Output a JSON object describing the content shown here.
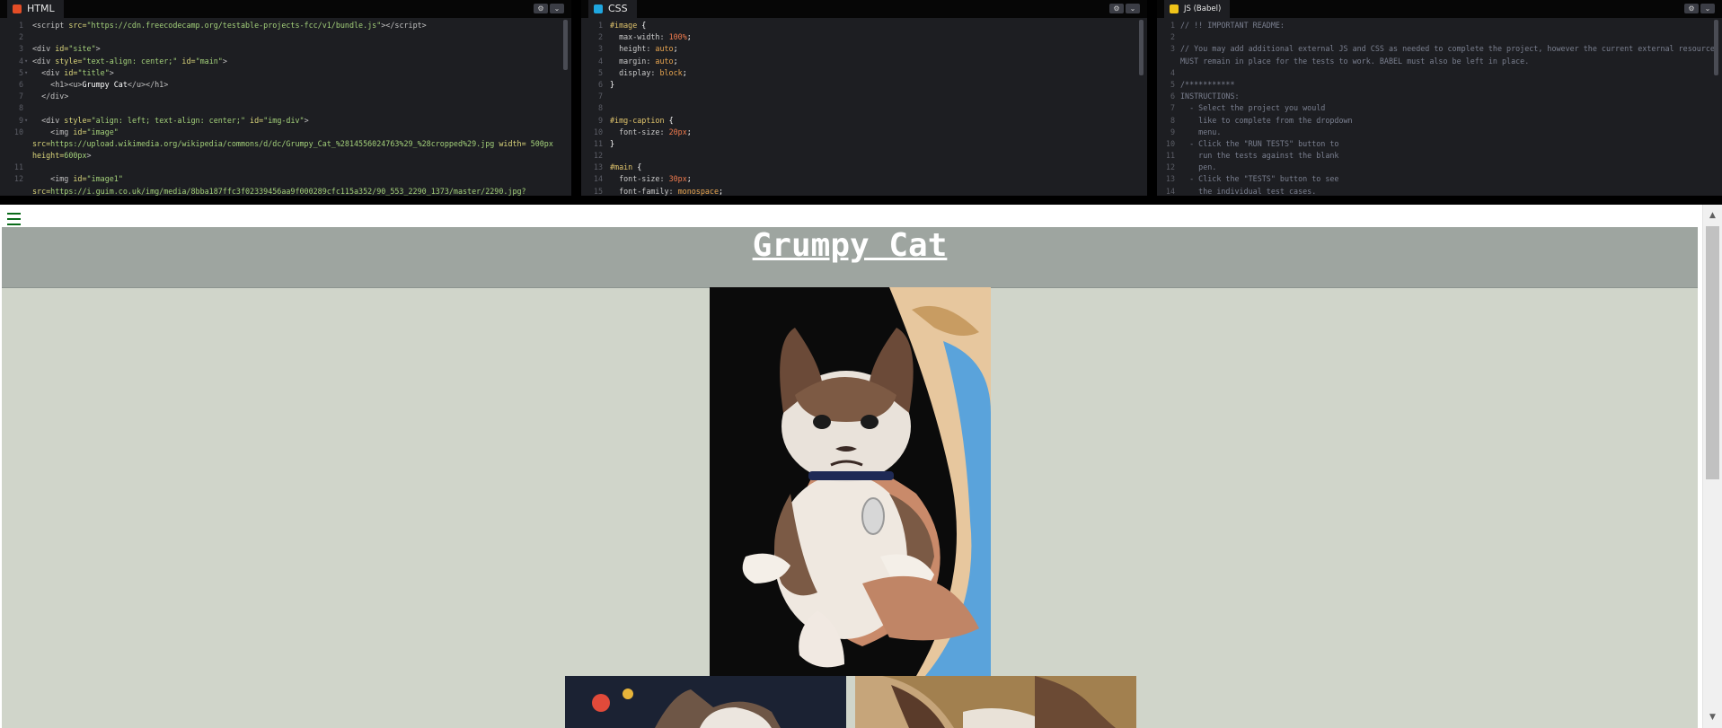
{
  "editors": {
    "html": {
      "label": "HTML",
      "badge_color": "#e44d26",
      "lines": [
        {
          "n": "1",
          "parts": [
            [
              "t-tag",
              "<script "
            ],
            [
              "t-attr",
              "src="
            ],
            [
              "t-str",
              "\"https://cdn.freecodecamp.org/testable-projects-fcc/v1/bundle.js\""
            ],
            [
              "t-tag",
              "></"
            ],
            [
              "t-tag",
              "script>"
            ]
          ]
        },
        {
          "n": "2",
          "parts": []
        },
        {
          "n": "3",
          "parts": [
            [
              "t-tag",
              "<div "
            ],
            [
              "t-attr",
              "id="
            ],
            [
              "t-str",
              "\"site\""
            ],
            [
              "t-tag",
              ">"
            ]
          ]
        },
        {
          "n": "4",
          "fold": true,
          "parts": [
            [
              "t-tag",
              "<div "
            ],
            [
              "t-attr",
              "style="
            ],
            [
              "t-str",
              "\"text-align: center;\""
            ],
            [
              "t-tag",
              " "
            ],
            [
              "t-attr",
              "id="
            ],
            [
              "t-str",
              "\"main\""
            ],
            [
              "t-tag",
              ">"
            ]
          ]
        },
        {
          "n": "5",
          "fold": true,
          "parts": [
            [
              "t-tag",
              "  <div "
            ],
            [
              "t-attr",
              "id="
            ],
            [
              "t-str",
              "\"title\""
            ],
            [
              "t-tag",
              ">"
            ]
          ]
        },
        {
          "n": "6",
          "parts": [
            [
              "t-tag",
              "    <h1><u>"
            ],
            [
              "t-text",
              "Grumpy Cat"
            ],
            [
              "t-tag",
              "</u></h1>"
            ]
          ]
        },
        {
          "n": "7",
          "parts": [
            [
              "t-tag",
              "  </div>"
            ]
          ]
        },
        {
          "n": "8",
          "parts": []
        },
        {
          "n": "9",
          "fold": true,
          "parts": [
            [
              "t-tag",
              "  <div "
            ],
            [
              "t-attr",
              "style="
            ],
            [
              "t-str",
              "\"align: left; text-align: center;\""
            ],
            [
              "t-tag",
              " "
            ],
            [
              "t-attr",
              "id="
            ],
            [
              "t-str",
              "\"img-div\""
            ],
            [
              "t-tag",
              ">"
            ]
          ]
        },
        {
          "n": "10",
          "parts": [
            [
              "t-tag",
              "    <img "
            ],
            [
              "t-attr",
              "id="
            ],
            [
              "t-str",
              "\"image\""
            ]
          ]
        },
        {
          "n": "",
          "parts": [
            [
              "t-attr",
              "src="
            ],
            [
              "t-str",
              "https://upload.wikimedia.org/wikipedia/commons/d/dc/Grumpy_Cat_%2814556024763%29_%28cropped%29.jpg"
            ],
            [
              "t-tag",
              " "
            ],
            [
              "t-attr",
              "width="
            ],
            [
              "t-str",
              " 500px"
            ]
          ]
        },
        {
          "n": "",
          "parts": [
            [
              "t-attr",
              "height="
            ],
            [
              "t-str",
              "600px"
            ],
            [
              "t-tag",
              ">"
            ]
          ]
        },
        {
          "n": "11",
          "parts": []
        },
        {
          "n": "12",
          "parts": [
            [
              "t-tag",
              "    <img "
            ],
            [
              "t-attr",
              "id="
            ],
            [
              "t-str",
              "\"image1\""
            ]
          ]
        },
        {
          "n": "",
          "parts": [
            [
              "t-attr",
              "src="
            ],
            [
              "t-str",
              "https://i.guim.co.uk/img/media/8bba187ffc3f02339456aa9f000289cfc115a352/90_553_2290_1373/master/2290.jpg?"
            ]
          ]
        }
      ]
    },
    "css": {
      "label": "CSS",
      "badge_color": "#1fa7e0",
      "lines": [
        {
          "n": "1",
          "parts": [
            [
              "t-sel",
              "#image "
            ],
            [
              "t-br",
              "{"
            ]
          ]
        },
        {
          "n": "2",
          "parts": [
            [
              "t-prop",
              "  max-width: "
            ],
            [
              "t-num",
              "100%"
            ],
            [
              "t-br",
              ";"
            ]
          ]
        },
        {
          "n": "3",
          "parts": [
            [
              "t-prop",
              "  height: "
            ],
            [
              "t-val",
              "auto"
            ],
            [
              "t-br",
              ";"
            ]
          ]
        },
        {
          "n": "4",
          "parts": [
            [
              "t-prop",
              "  margin: "
            ],
            [
              "t-val",
              "auto"
            ],
            [
              "t-br",
              ";"
            ]
          ]
        },
        {
          "n": "5",
          "parts": [
            [
              "t-prop",
              "  display: "
            ],
            [
              "t-val",
              "block"
            ],
            [
              "t-br",
              ";"
            ]
          ]
        },
        {
          "n": "6",
          "parts": [
            [
              "t-br",
              "}"
            ]
          ]
        },
        {
          "n": "7",
          "parts": []
        },
        {
          "n": "8",
          "parts": []
        },
        {
          "n": "9",
          "parts": [
            [
              "t-sel",
              "#img-caption "
            ],
            [
              "t-br",
              "{"
            ]
          ]
        },
        {
          "n": "10",
          "parts": [
            [
              "t-prop",
              "  font-size: "
            ],
            [
              "t-num",
              "20px"
            ],
            [
              "t-br",
              ";"
            ]
          ]
        },
        {
          "n": "11",
          "parts": [
            [
              "t-br",
              "}"
            ]
          ]
        },
        {
          "n": "12",
          "parts": []
        },
        {
          "n": "13",
          "parts": [
            [
              "t-sel",
              "#main "
            ],
            [
              "t-br",
              "{"
            ]
          ]
        },
        {
          "n": "14",
          "parts": [
            [
              "t-prop",
              "  font-size: "
            ],
            [
              "t-num",
              "30px"
            ],
            [
              "t-br",
              ";"
            ]
          ]
        },
        {
          "n": "15",
          "parts": [
            [
              "t-prop",
              "  font-family: "
            ],
            [
              "t-val",
              "monospace"
            ],
            [
              "t-br",
              ";"
            ]
          ]
        }
      ]
    },
    "js": {
      "label": "JS (Babel)",
      "badge_color": "#f0c419",
      "lines": [
        {
          "n": "1",
          "parts": [
            [
              "t-com",
              "// !! IMPORTANT README:"
            ]
          ]
        },
        {
          "n": "2",
          "parts": []
        },
        {
          "n": "3",
          "parts": [
            [
              "t-com",
              "// You may add additional external JS and CSS as needed to complete the project, however the current external resource"
            ]
          ]
        },
        {
          "n": "",
          "parts": [
            [
              "t-com",
              "MUST remain in place for the tests to work. BABEL must also be left in place."
            ]
          ]
        },
        {
          "n": "4",
          "parts": []
        },
        {
          "n": "5",
          "parts": [
            [
              "t-com",
              "/***********"
            ]
          ]
        },
        {
          "n": "6",
          "parts": [
            [
              "t-com",
              "INSTRUCTIONS:"
            ]
          ]
        },
        {
          "n": "7",
          "parts": [
            [
              "t-com",
              "  - Select the project you would"
            ]
          ]
        },
        {
          "n": "8",
          "parts": [
            [
              "t-com",
              "    like to complete from the dropdown"
            ]
          ]
        },
        {
          "n": "9",
          "parts": [
            [
              "t-com",
              "    menu."
            ]
          ]
        },
        {
          "n": "10",
          "parts": [
            [
              "t-com",
              "  - Click the \"RUN TESTS\" button to"
            ]
          ]
        },
        {
          "n": "11",
          "parts": [
            [
              "t-com",
              "    run the tests against the blank"
            ]
          ]
        },
        {
          "n": "12",
          "parts": [
            [
              "t-com",
              "    pen."
            ]
          ]
        },
        {
          "n": "13",
          "parts": [
            [
              "t-com",
              "  - Click the \"TESTS\" button to see"
            ]
          ]
        },
        {
          "n": "14",
          "parts": [
            [
              "t-com",
              "    the individual test cases."
            ]
          ]
        }
      ]
    }
  },
  "pane_controls": {
    "settings_icon": "gear-icon",
    "collapse_icon": "chevron-down-icon"
  },
  "preview": {
    "title": "Grumpy Cat",
    "background": "#d0d5ca",
    "title_band_color": "#9ea5a0"
  }
}
